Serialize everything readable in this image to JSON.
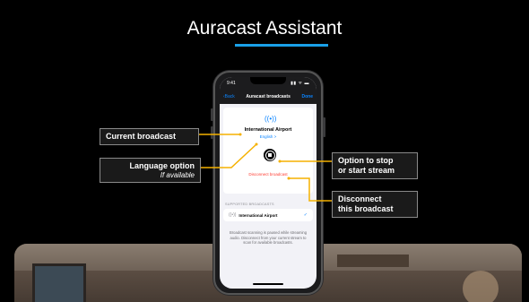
{
  "slide": {
    "title": "Auracast Assistant",
    "accent_color": "#1aa0e8",
    "callout_line_color": "#f5b100"
  },
  "phone": {
    "status_time": "9:41",
    "status_icons": "▮▮ ᯤ ▬",
    "nav": {
      "back_label": "Back",
      "title": "Auracast broadcasts",
      "done_label": "Done"
    },
    "current": {
      "icon": "broadcast-icon",
      "name": "International Airport",
      "language": "English >",
      "stop_icon": "stop-icon",
      "disconnect_label": "Disconnect broadcast"
    },
    "supported_header": "SUPPORTED BROADCASTS",
    "supported": [
      {
        "name": "International Airport",
        "checked": "✓"
      }
    ],
    "note": "Broadcast scanning is paused while streaming audio. Disconnect from your current stream to scan for available broadcasts."
  },
  "callouts": {
    "current_broadcast": "Current broadcast",
    "language_option": "Language option",
    "language_option_sub": "If available",
    "option_stop_start_1": "Option to stop",
    "option_stop_start_2": "or start stream",
    "disconnect_1": "Disconnect",
    "disconnect_2": "this broadcast"
  }
}
